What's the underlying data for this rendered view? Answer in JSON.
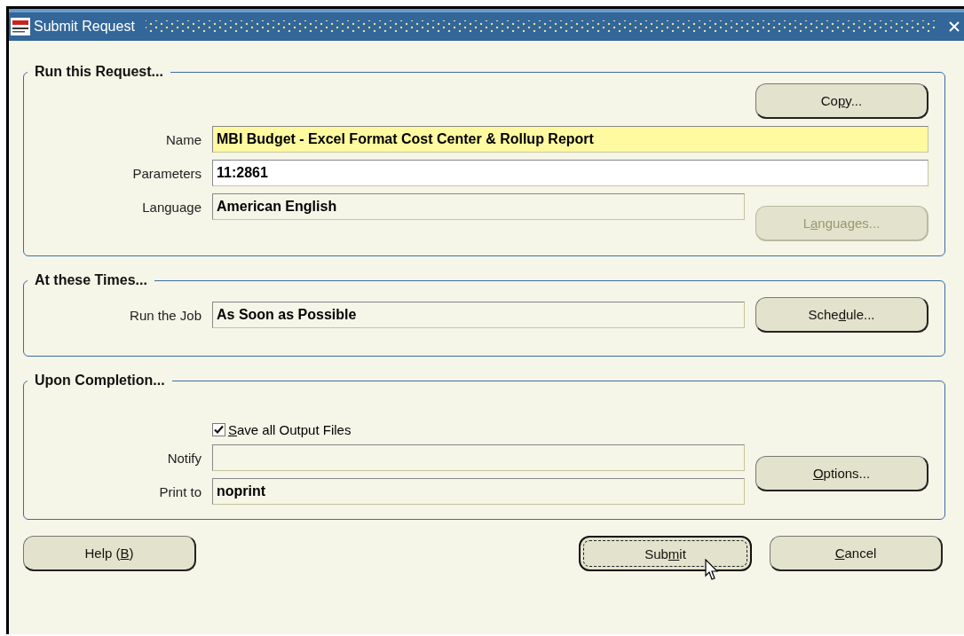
{
  "window": {
    "title": "Submit Request"
  },
  "run_request": {
    "title": "Run this Request...",
    "copy_button": {
      "label_start": "Co",
      "access_key": "p",
      "label_end": "y...",
      "disabled": false
    },
    "fields": [
      {
        "label": "Name",
        "value": "MBI Budget - Excel Format Cost Center & Rollup Report",
        "kind": "required"
      },
      {
        "label": "Parameters",
        "value": "11:2861",
        "kind": "editable"
      },
      {
        "label": "Language",
        "value": "American English",
        "kind": "readonly"
      }
    ],
    "languages_button": {
      "label_start": "L",
      "access_key": "a",
      "label_end": "nguages...",
      "disabled": true
    }
  },
  "times": {
    "title": "At these Times...",
    "fields": [
      {
        "label": "Run the Job",
        "value": "As Soon as Possible",
        "kind": "readonly"
      }
    ],
    "schedule_button": {
      "label_start": "Sche",
      "access_key": "d",
      "label_end": "ule...",
      "disabled": false
    }
  },
  "completion": {
    "title": "Upon Completion...",
    "save_output": {
      "access_key": "S",
      "label_end": "ave all Output Files",
      "checked": true
    },
    "fields": [
      {
        "label": "Notify",
        "kind": "readonly"
      },
      {
        "label": "Print to",
        "value": "noprint",
        "kind": "readonly"
      }
    ],
    "options_button": {
      "access_key": "O",
      "label_end": "ptions...",
      "disabled": false
    }
  },
  "footer_buttons": [
    {
      "label_start": "Help (",
      "access_key": "B",
      "label_end": ")",
      "focused": false
    },
    {
      "label_start": "Sub",
      "access_key": "m",
      "label_end": "it",
      "focused": true
    },
    {
      "access_key": "C",
      "label_end": "ancel",
      "focused": false
    }
  ]
}
